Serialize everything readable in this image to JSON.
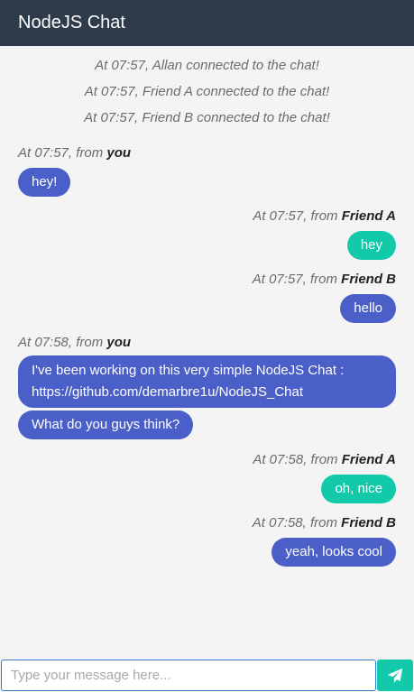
{
  "header": {
    "title": "NodeJS Chat"
  },
  "system_messages": [
    "At 07:57, Allan connected to the chat!",
    "At 07:57, Friend A connected to the chat!",
    "At 07:57, Friend B connected to the chat!"
  ],
  "messages": [
    {
      "meta_prefix": "At 07:57, from ",
      "sender": "you",
      "texts": [
        "hey!"
      ]
    },
    {
      "meta_prefix": "At 07:57, from ",
      "sender": "Friend A",
      "texts": [
        "hey"
      ]
    },
    {
      "meta_prefix": "At 07:57, from ",
      "sender": "Friend B",
      "texts": [
        "hello"
      ]
    },
    {
      "meta_prefix": "At 07:58, from ",
      "sender": "you",
      "texts": [
        "I've been working on this very simple NodeJS Chat : https://github.com/demarbre1u/NodeJS_Chat",
        "What do you guys think?"
      ]
    },
    {
      "meta_prefix": "At 07:58, from ",
      "sender": "Friend A",
      "texts": [
        "oh, nice"
      ]
    },
    {
      "meta_prefix": "At 07:58, from ",
      "sender": "Friend B",
      "texts": [
        "yeah, looks cool"
      ]
    }
  ],
  "input": {
    "placeholder": "Type your message here...",
    "value": ""
  },
  "send_button": {
    "icon": "paper-plane-icon"
  },
  "colors": {
    "header_bg": "#2e3b4b",
    "own_bubble": "#4b5fc8",
    "friend_a_bubble": "#12c9a9",
    "friend_b_bubble": "#4b5fc8",
    "send_button": "#12c9a9",
    "input_border": "#3b78c8"
  }
}
